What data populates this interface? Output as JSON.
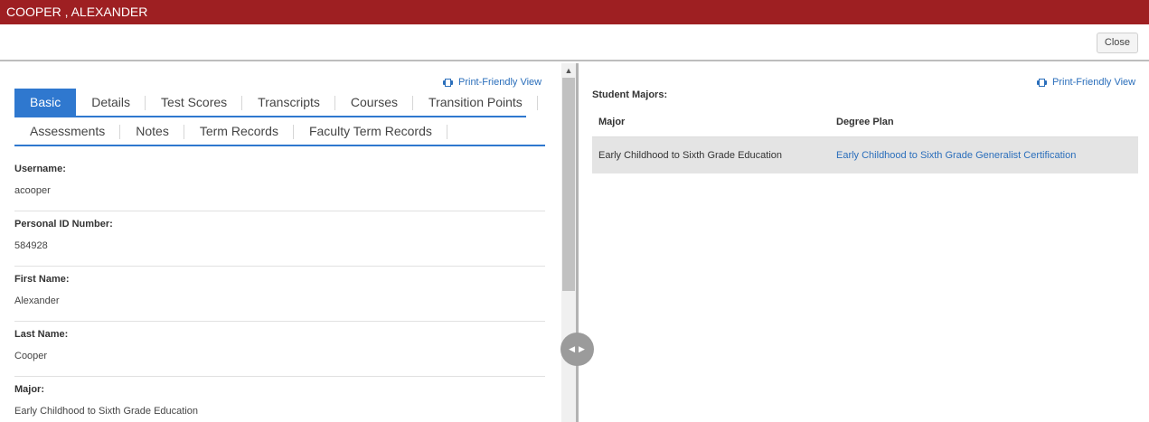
{
  "header": {
    "title": "COOPER , ALEXANDER"
  },
  "toolbar": {
    "close_label": "Close"
  },
  "left": {
    "print_label": "Print-Friendly View",
    "tabs_row1": [
      "Basic",
      "Details",
      "Test Scores",
      "Transcripts",
      "Courses",
      "Transition Points"
    ],
    "tabs_row2": [
      "Assessments",
      "Notes",
      "Term Records",
      "Faculty Term Records"
    ],
    "active_tab": "Basic",
    "fields": [
      {
        "label": "Username:",
        "value": "acooper"
      },
      {
        "label": "Personal ID Number:",
        "value": "584928"
      },
      {
        "label": "First Name:",
        "value": "Alexander"
      },
      {
        "label": "Last Name:",
        "value": "Cooper"
      },
      {
        "label": "Major:",
        "value": "Early Childhood to Sixth Grade Education"
      }
    ]
  },
  "right": {
    "print_label": "Print-Friendly View",
    "section_title": "Student Majors:",
    "columns": [
      "Major",
      "Degree Plan"
    ],
    "rows": [
      {
        "major": "Early Childhood to Sixth Grade Education",
        "degree_plan": "Early Childhood to Sixth Grade Generalist Certification"
      }
    ]
  },
  "icons": {
    "print": "printer-icon",
    "scroll_up": "chevron-up-icon",
    "split": "split-arrows-icon"
  },
  "colors": {
    "header_bg": "#9e1f22",
    "accent": "#2f78cf",
    "link": "#2a6ebb"
  }
}
